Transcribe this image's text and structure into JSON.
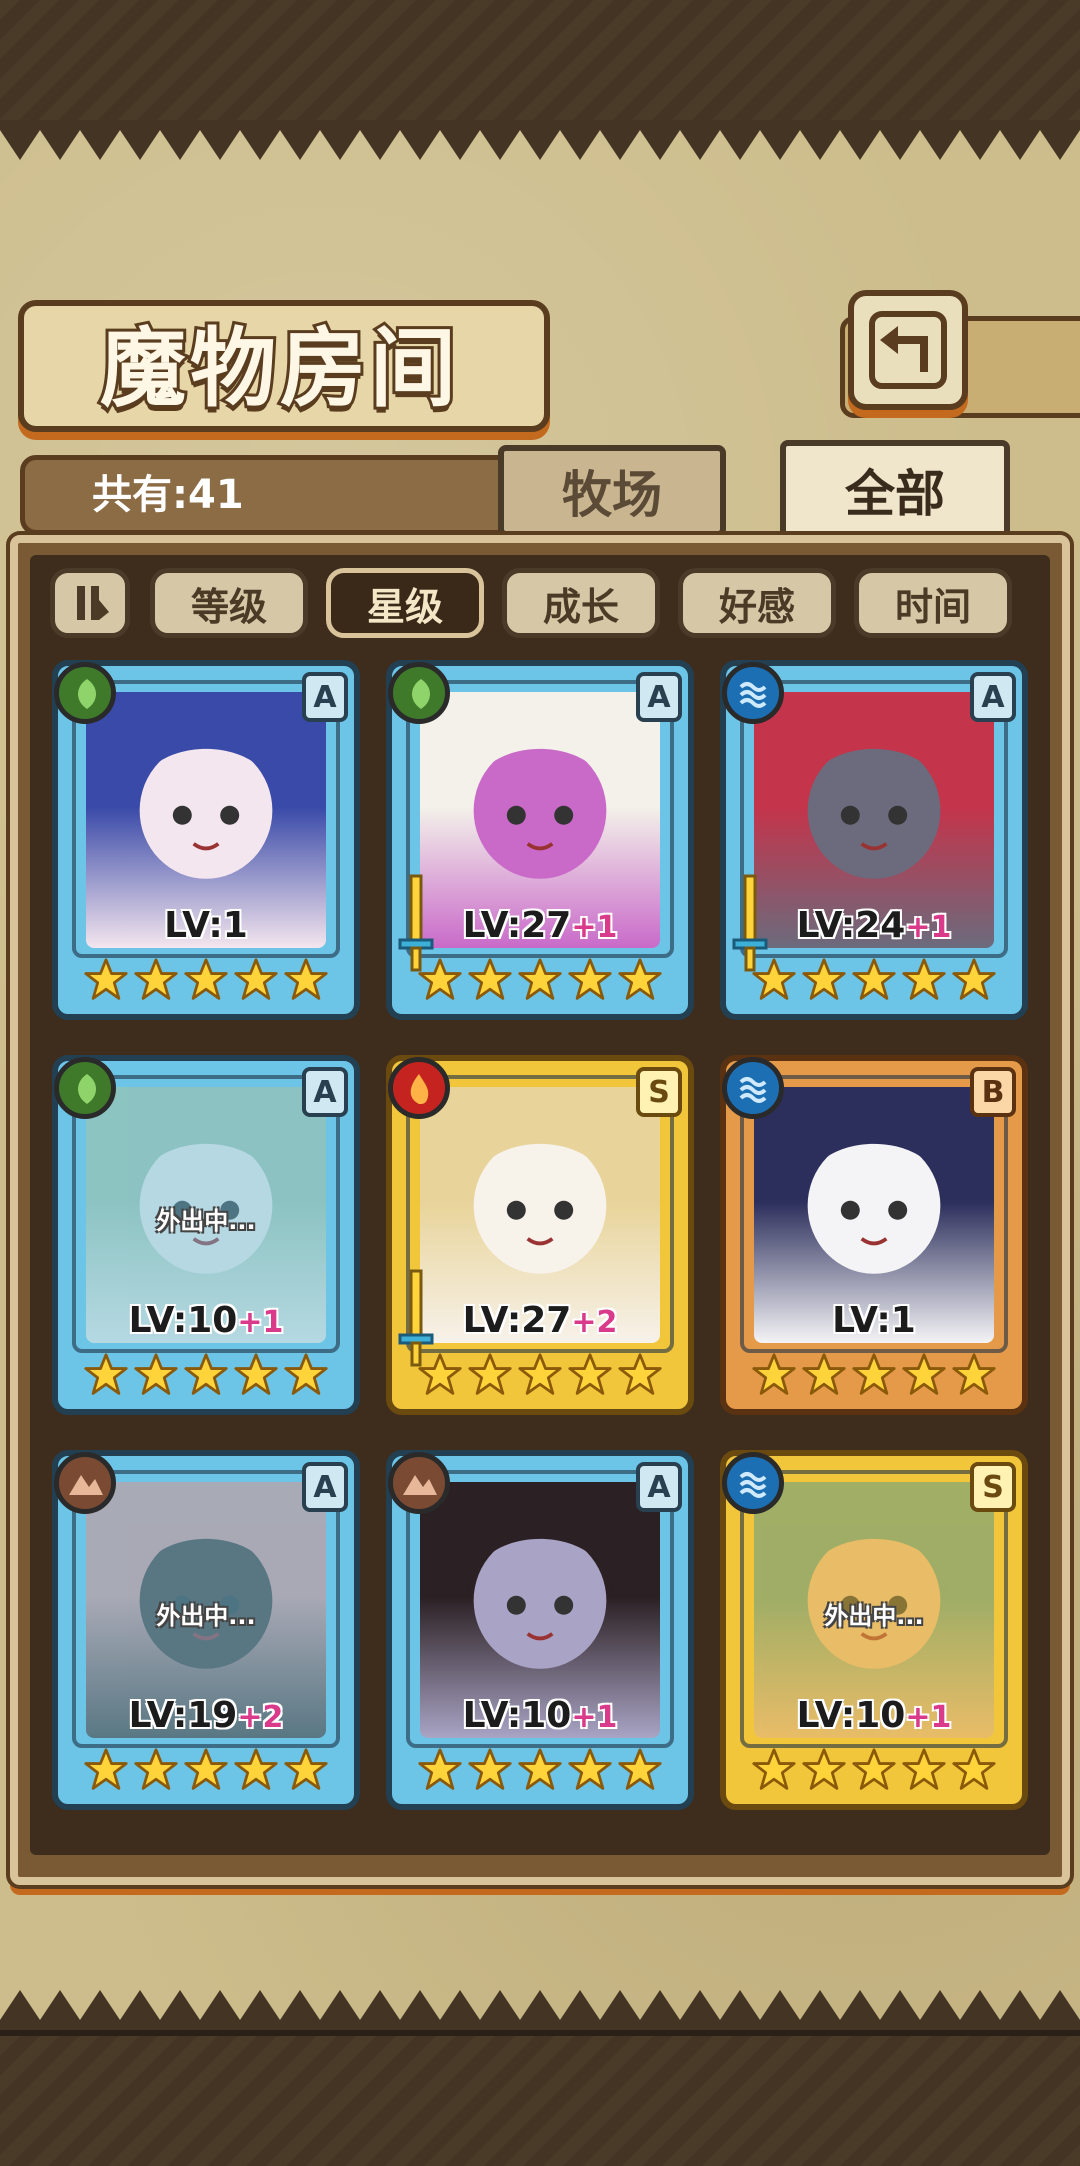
{
  "title": "魔物房间",
  "count_label": "共有:41",
  "tabs": {
    "ranch": "牧场",
    "all": "全部"
  },
  "sort": {
    "level": "等级",
    "star": "星级",
    "growth": "成长",
    "affection": "好感",
    "time": "时间"
  },
  "away_label": "外出中...",
  "colors": {
    "leaf": "#3f7a2a",
    "water": "#1d6fb3",
    "fire": "#c4231f",
    "earth": "#7a4a32"
  },
  "monsters": [
    {
      "element": "leaf-icon",
      "rank": "A",
      "lv": "LV:1",
      "plus": "",
      "stars": 5,
      "away": false,
      "weapon": false
    },
    {
      "element": "leaf-icon",
      "rank": "A",
      "lv": "LV:27",
      "plus": "+1",
      "stars": 5,
      "away": false,
      "weapon": true
    },
    {
      "element": "water-icon",
      "rank": "A",
      "lv": "LV:24",
      "plus": "+1",
      "stars": 5,
      "away": false,
      "weapon": true
    },
    {
      "element": "leaf-icon",
      "rank": "A",
      "lv": "LV:10",
      "plus": "+1",
      "stars": 5,
      "away": true,
      "weapon": false
    },
    {
      "element": "fire-icon",
      "rank": "S",
      "lv": "LV:27",
      "plus": "+2",
      "stars": 5,
      "away": false,
      "weapon": true
    },
    {
      "element": "water-icon",
      "rank": "B",
      "lv": "LV:1",
      "plus": "",
      "stars": 5,
      "away": false,
      "weapon": false
    },
    {
      "element": "earth-icon",
      "rank": "A",
      "lv": "LV:19",
      "plus": "+2",
      "stars": 5,
      "away": true,
      "weapon": false
    },
    {
      "element": "earth-icon",
      "rank": "A",
      "lv": "LV:10",
      "plus": "+1",
      "stars": 5,
      "away": false,
      "weapon": false
    },
    {
      "element": "water-icon",
      "rank": "S",
      "lv": "LV:10",
      "plus": "+1",
      "stars": 5,
      "away": true,
      "weapon": false
    }
  ]
}
